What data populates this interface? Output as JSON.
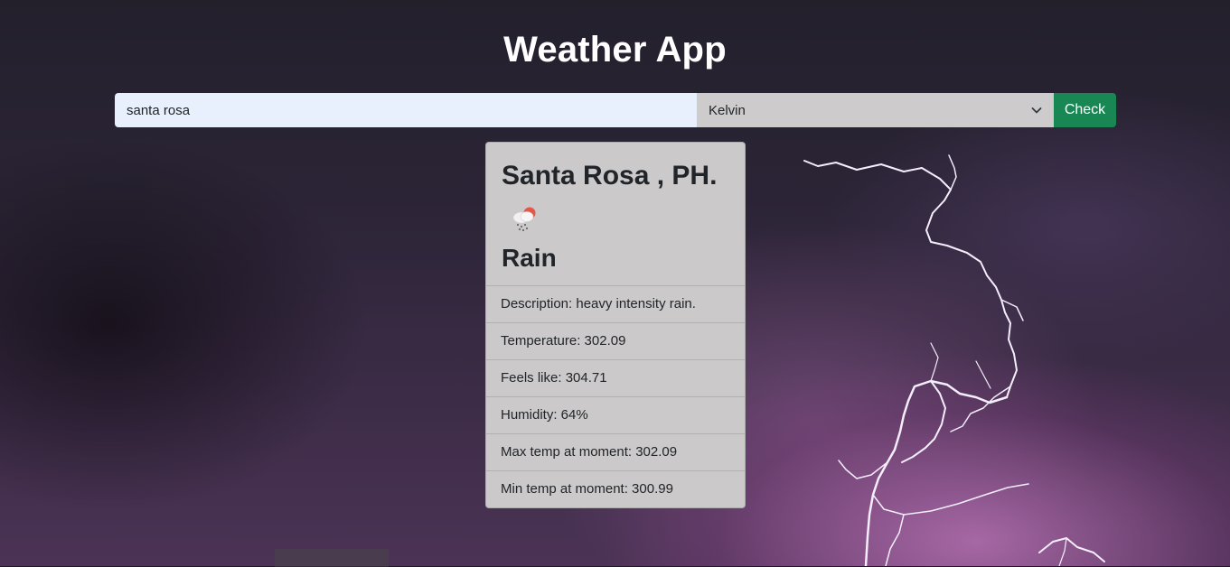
{
  "app": {
    "title": "Weather App"
  },
  "search": {
    "city_value": "santa rosa"
  },
  "unit_select": {
    "selected": "Kelvin"
  },
  "check_button": {
    "label": "Check"
  },
  "result": {
    "location": "Santa Rosa , PH.",
    "icon": "rain-cloud-icon",
    "condition": "Rain",
    "details": [
      "Description: heavy intensity rain.",
      "Temperature: 302.09",
      "Feels like: 304.71",
      "Humidity: 64%",
      "Max temp at moment: 302.09",
      "Min temp at moment: 300.99"
    ]
  },
  "colors": {
    "check_button": "#198754",
    "card_background": "#cbc9c9",
    "input_background": "#e8f0fe",
    "select_background": "#cdcbcb",
    "bolt": "#f4eefc"
  }
}
